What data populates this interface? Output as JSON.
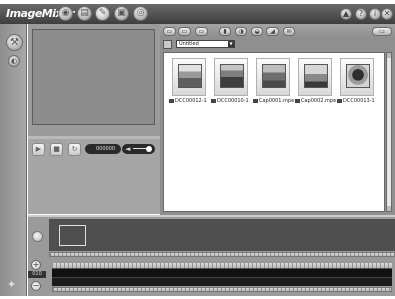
{
  "app": {
    "logo": "ImageMixer",
    "colors": {
      "header": "#4e4e4e",
      "panel": "#9a9a9a",
      "library": "#8f8f8f",
      "dark": "#1a1a1a"
    }
  },
  "header": {
    "mode_icons": [
      "capture-icon",
      "album-icon",
      "edit-icon",
      "output-icon",
      "burn-icon"
    ],
    "right_icons": [
      "settings-icon",
      "help-icon",
      "info-icon",
      "exit-icon"
    ]
  },
  "sidebar": {
    "icons": [
      "tools-icon",
      "web-icon"
    ],
    "bottom_icon": "effects-icon"
  },
  "toolbar": {
    "album_select": "Untitled"
  },
  "library": {
    "items": [
      {
        "label": "DCC00012-1",
        "type": "photo"
      },
      {
        "label": "DCC00010-1",
        "type": "photo"
      },
      {
        "label": "Cap0001.mpe",
        "type": "video"
      },
      {
        "label": "Cap0002.mpe",
        "type": "video"
      },
      {
        "label": "DCC00013-1",
        "type": "photo"
      }
    ]
  },
  "player": {
    "time": "000000"
  },
  "timeline": {
    "zoom_value": "010"
  }
}
